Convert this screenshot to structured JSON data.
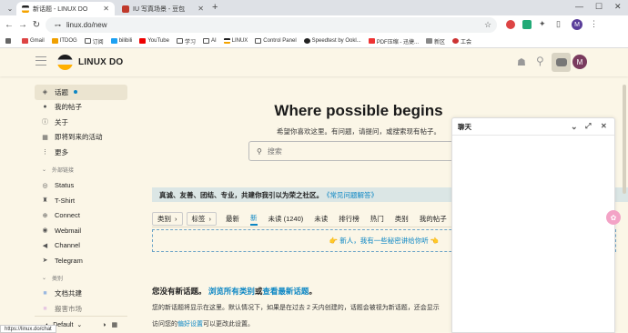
{
  "browser": {
    "tabs": [
      {
        "title": "新话题 - LINUX DO",
        "active": true
      },
      {
        "title": "IU 写真场景 - 豆包",
        "active": false
      }
    ],
    "new_tab": "+",
    "url": "linux.do/new",
    "profile_initial": "M",
    "bookmarks": [
      "Gmail",
      "ITDOG",
      "订阅",
      "bilibili",
      "YouTube",
      "学习",
      "AI",
      "LINUX",
      "Control Panel",
      "Speedtest by Ookl...",
      "PDF压缩 - 迅捷...",
      "新区",
      "工会"
    ]
  },
  "site": {
    "name": "LINUX DO",
    "avatar_initial": "M"
  },
  "sidebar": {
    "items": [
      {
        "label": "话题",
        "icon": "layers-icon",
        "active": true
      },
      {
        "label": "我的帖子",
        "icon": "user-icon"
      },
      {
        "label": "关于",
        "icon": "info-icon"
      },
      {
        "label": "即将到来的活动",
        "icon": "calendar-icon"
      },
      {
        "label": "更多",
        "icon": "more-icon"
      }
    ],
    "links_section": "外部链接",
    "links": [
      {
        "label": "Status",
        "icon": "status-icon"
      },
      {
        "label": "T-Shirt",
        "icon": "tshirt-icon"
      },
      {
        "label": "Connect",
        "icon": "connect-icon"
      },
      {
        "label": "Webmail",
        "icon": "mail-icon"
      },
      {
        "label": "Channel",
        "icon": "channel-icon"
      },
      {
        "label": "Telegram",
        "icon": "telegram-icon"
      }
    ],
    "cat_section": "类别",
    "categories": [
      {
        "label": "文档共建"
      },
      {
        "label": "搬害市场"
      }
    ],
    "footer": {
      "default_label": "Default"
    }
  },
  "hero": {
    "title": "Where possible begins",
    "subtitle": "希望你喜欢这里。有问题，请提问，或搜索现有帖子。",
    "search_placeholder": "搜索"
  },
  "banner": {
    "text": "真诚、友善、团结、专业，共建你我引以为荣之社区。",
    "link": "《常见问题解答》"
  },
  "filters": {
    "category": "类别",
    "tags": "标签",
    "tabs": [
      "最新",
      "新",
      "未读 (1240)",
      "未读",
      "排行榜",
      "热门",
      "类别",
      "我的帖子"
    ]
  },
  "notice": "👉 新人，我有一些秘密讲给你听 👈",
  "empty": {
    "heading_prefix": "您没有新话题。",
    "heading_link1": "浏览所有类别",
    "heading_mid": "或",
    "heading_link2": "查看最新话题",
    "heading_suffix": "。",
    "body1": "您的新话题将显示在这里。默认情况下，如果是在过去 2 天内创建的，话题会被视为新话题，还会显示",
    "body2_prefix": "访问您的",
    "body2_link": "偏好设置",
    "body2_suffix": "可以更改此设置。"
  },
  "chat": {
    "title": "聊天"
  },
  "statusbar": "https://linux.do/chat",
  "colors": {
    "accent": "#0b86c4",
    "bg": "#fbf6e7",
    "banner_bg": "#dbe6e5"
  }
}
